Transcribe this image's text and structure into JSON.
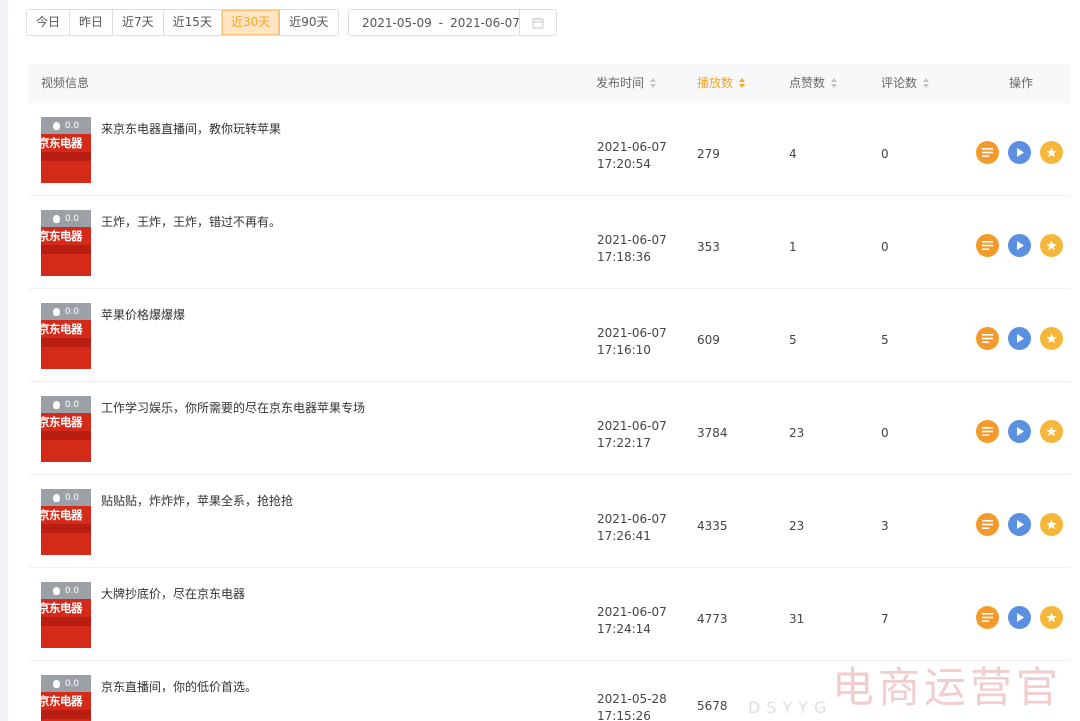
{
  "filter": {
    "quick_ranges": [
      {
        "label": "今日",
        "active": false
      },
      {
        "label": "昨日",
        "active": false
      },
      {
        "label": "近7天",
        "active": false
      },
      {
        "label": "近15天",
        "active": false
      },
      {
        "label": "近30天",
        "active": true
      },
      {
        "label": "近90天",
        "active": false
      }
    ],
    "date_start": "2021-05-09",
    "date_separator": "-",
    "date_end": "2021-06-07",
    "calendar_icon": "calendar-icon"
  },
  "table": {
    "columns": {
      "video_info": "视频信息",
      "publish_time": "发布时间",
      "plays": "播放数",
      "likes": "点赞数",
      "comments": "评论数",
      "actions": "操作"
    },
    "sorted_column": "plays",
    "rows": [
      {
        "heat": "0.0",
        "brand": "京东电器",
        "title": "来京东电器直播间，教你玩转苹果",
        "date": "2021-06-07",
        "time": "17:20:54",
        "plays": "279",
        "likes": "4",
        "comments": "0"
      },
      {
        "heat": "0.0",
        "brand": "京东电器",
        "title": "王炸，王炸，王炸，错过不再有。",
        "date": "2021-06-07",
        "time": "17:18:36",
        "plays": "353",
        "likes": "1",
        "comments": "0"
      },
      {
        "heat": "0.0",
        "brand": "京东电器",
        "title": "苹果价格爆爆爆",
        "date": "2021-06-07",
        "time": "17:16:10",
        "plays": "609",
        "likes": "5",
        "comments": "5"
      },
      {
        "heat": "0.0",
        "brand": "京东电器",
        "title": "工作学习娱乐，你所需要的尽在京东电器苹果专场",
        "date": "2021-06-07",
        "time": "17:22:17",
        "plays": "3784",
        "likes": "23",
        "comments": "0"
      },
      {
        "heat": "0.0",
        "brand": "京东电器",
        "title": "贴贴贴，炸炸炸，苹果全系，抢抢抢",
        "date": "2021-06-07",
        "time": "17:26:41",
        "plays": "4335",
        "likes": "23",
        "comments": "3"
      },
      {
        "heat": "0.0",
        "brand": "京东电器",
        "title": "大牌抄底价，尽在京东电器",
        "date": "2021-06-07",
        "time": "17:24:14",
        "plays": "4773",
        "likes": "31",
        "comments": "7"
      },
      {
        "heat": "0.0",
        "brand": "京东电器",
        "title": "京东直播间，你的低价首选。",
        "date": "2021-05-28",
        "time": "17:15:26",
        "plays": "5678",
        "likes": "",
        "comments": ""
      }
    ],
    "action_icons": [
      "detail-list-icon",
      "play-icon",
      "star-icon"
    ]
  },
  "watermark": {
    "text": "电商运营官",
    "subtext": "DSYYG"
  },
  "colors": {
    "accent": "#f5a623",
    "detail": "#f39a2b",
    "play": "#5b8fe0",
    "favorite": "#f5b63a",
    "thumb_red": "#d42a1a"
  }
}
